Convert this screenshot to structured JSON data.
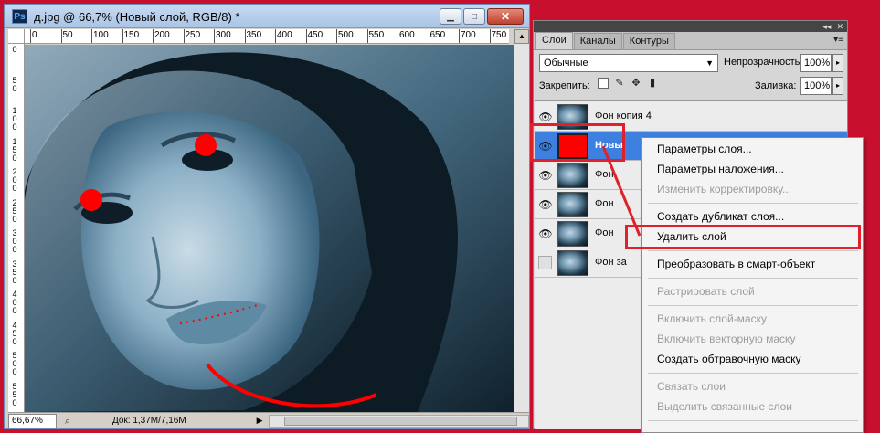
{
  "document": {
    "title": "д.jpg @ 66,7% (Новый слой, RGB/8) *",
    "app_icon": "Ps",
    "window_buttons": {
      "minimize": "▁",
      "maximize": "□",
      "close": "✕"
    },
    "ruler_top_labels": [
      "0",
      "50",
      "100",
      "150",
      "200",
      "250",
      "300",
      "350",
      "400",
      "450",
      "500",
      "550",
      "600",
      "650",
      "700",
      "750"
    ],
    "ruler_left_labels": [
      "0",
      "5 0",
      "1 0 0",
      "1 5 0",
      "2 0 0",
      "2 5 0",
      "3 0 0",
      "3 5 0",
      "4 0 0",
      "4 5 0",
      "5 0 0",
      "5 5 0"
    ],
    "zoom": "66,67%",
    "doc_info": "Док: 1,37M/7,16M",
    "status_arrow": "▶",
    "scroll_up": "▲"
  },
  "panel": {
    "top_controls": [
      "◂◂",
      "✕"
    ],
    "tabs": [
      {
        "label": "Слои",
        "active": true
      },
      {
        "label": "Каналы",
        "active": false
      },
      {
        "label": "Контуры",
        "active": false
      }
    ],
    "menu_icon": "▾≡",
    "blend_mode": "Обычные",
    "blend_arrow": "▼",
    "opacity_label": "Непрозрачность:",
    "opacity_value": "100%",
    "lock_label": "Закрепить:",
    "lock_icons": [
      "transparency-lock-icon",
      "brush-icon",
      "move-icon",
      "lock-icon"
    ],
    "fill_label": "Заливка:",
    "fill_value": "100%",
    "stepper_arrow": "▸",
    "layers": [
      {
        "name": "Фон копия 4",
        "visible": true,
        "thumb": "photo",
        "selected": false
      },
      {
        "name": "Новы",
        "visible": true,
        "thumb": "red",
        "selected": true
      },
      {
        "name": "Фон",
        "visible": true,
        "thumb": "photo",
        "selected": false
      },
      {
        "name": "Фон",
        "visible": true,
        "thumb": "photo",
        "selected": false
      },
      {
        "name": "Фон",
        "visible": true,
        "thumb": "photo",
        "selected": false
      },
      {
        "name": "Фон за",
        "visible": false,
        "thumb": "photo",
        "selected": false
      }
    ]
  },
  "context_menu": {
    "items": [
      {
        "label": "Параметры слоя...",
        "enabled": true
      },
      {
        "label": "Параметры наложения...",
        "enabled": true
      },
      {
        "label": "Изменить корректировку...",
        "enabled": false
      },
      {
        "label": "Создать дубликат слоя...",
        "enabled": true
      },
      {
        "label": "Удалить слой",
        "enabled": true,
        "highlighted": true
      },
      {
        "label": "Преобразовать в смарт-объект",
        "enabled": true
      },
      {
        "label": "Растрировать слой",
        "enabled": false
      },
      {
        "label": "Включить слой-маску",
        "enabled": false
      },
      {
        "label": "Включить векторную маску",
        "enabled": false
      },
      {
        "label": "Создать обтравочную маску",
        "enabled": true
      },
      {
        "label": "Связать слои",
        "enabled": false
      },
      {
        "label": "Выделить связанные слои",
        "enabled": false
      }
    ]
  },
  "colors": {
    "background_frame": "#c8102e",
    "annotation_red": "#e0202a",
    "selected_layer": "#3d80df",
    "red_fill": "#ff0000"
  }
}
